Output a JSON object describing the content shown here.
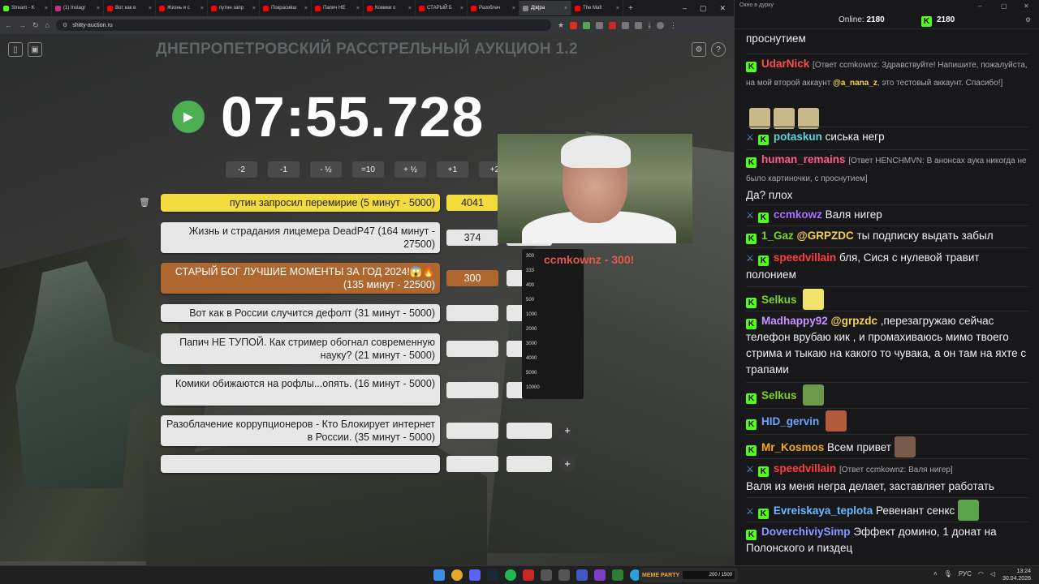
{
  "browser": {
    "tabs": [
      {
        "label": "Stream - K",
        "color": "#53fc18"
      },
      {
        "label": "(1) Instagr",
        "color": "#c13584"
      },
      {
        "label": "Вот как в",
        "color": "#ff0000"
      },
      {
        "label": "Жизнь и с",
        "color": "#ff0000"
      },
      {
        "label": "путин запр",
        "color": "#ff0000"
      },
      {
        "label": "Покрасивш",
        "color": "#ff0000"
      },
      {
        "label": "Папич НЕ",
        "color": "#ff0000"
      },
      {
        "label": "Комики о",
        "color": "#ff0000"
      },
      {
        "label": "СТАРЫЙ Б",
        "color": "#ff0000"
      },
      {
        "label": "Разоблач",
        "color": "#ff0000"
      },
      {
        "label": "Д|в|ра",
        "color": "#888888"
      },
      {
        "label": "The Mafi",
        "color": "#ff0000"
      }
    ],
    "url": "shitty-auction.ru"
  },
  "page": {
    "title": "ДНЕПРОПЕТРОВСКИЙ РАССТРЕЛЬНЫЙ АУКЦИОН 1.2",
    "timer": "07:55.728",
    "time_buttons": [
      "-2",
      "-1",
      "- ½",
      "=10",
      "+ ½",
      "+1",
      "+2"
    ],
    "lots": [
      {
        "title": "путин запросил перемирие (5 минут - 5000)",
        "amount": "4041",
        "style": "yellow"
      },
      {
        "title": "Жизнь и страдания лицемера DeadP47 (164 минут - 27500)",
        "amount": "374",
        "style": "white"
      },
      {
        "title": "СТАРЫЙ БОГ ЛУЧШИЕ МОМЕНТЫ ЗА ГОД 2024!😱🔥 (135 минут - 22500)",
        "amount": "300",
        "style": "orange"
      },
      {
        "title": "Вот как в России случится дефолт (31 минут - 5000)",
        "amount": "",
        "style": "white"
      },
      {
        "title": "Папич НЕ ТУПОЙ. Как стример обогнал современную науку? (21 минут - 5000)",
        "amount": "",
        "style": "white"
      },
      {
        "title": "Комики обижаются на рофлы...опять. (16 минут - 5000)",
        "amount": "",
        "style": "white"
      },
      {
        "title": "Разоблачение коррупционеров - Кто Блокирует интернет в России. (35 минут - 5000)",
        "amount": "",
        "style": "white"
      },
      {
        "title": "",
        "amount": "",
        "style": "white"
      }
    ],
    "donation_text": "ccmkownz - 300!",
    "dropdown_options": [
      "300",
      "333",
      "400",
      "500",
      "1000",
      "2000",
      "3000",
      "4000",
      "5000",
      "10000"
    ]
  },
  "chat": {
    "window_title": "Окно в дурку",
    "online_label": "Online:",
    "online_count": "2180",
    "k_count": "2180",
    "messages": [
      {
        "nick": "",
        "color": "#efeff1",
        "reply": "",
        "text": "проснутием",
        "sword": false
      },
      {
        "nick": "UdarNick",
        "color": "#ff4b4b",
        "reply": "[Ответ ccmkownz: Здравствуйте! Напишите, пожалуйста, на мой второй аккаунт ",
        "mention": "@a_nana_z",
        "reply_tail": ", это тестовый аккаунт. Спасибо!]",
        "text": "",
        "sword": false
      },
      {
        "nick": "potaskun",
        "color": "#5bd6d8",
        "reply": "",
        "text": "сиська негр",
        "sword": true
      },
      {
        "nick": "human_remains",
        "color": "#ff5c8a",
        "reply": "[Ответ HENCHMVN: В анонсах аука никогда не было картиночки, с проснутием]",
        "text": "Да? плох",
        "sword": false
      },
      {
        "nick": "ccmkowz",
        "color": "#a970ff",
        "reply": "",
        "text": "Валя нигер",
        "sword": true
      },
      {
        "nick": "1_Gaz",
        "color": "#7ed321",
        "reply": "",
        "mention": "@GRPZDC",
        "text": "ты подписку выдать забыл",
        "sword": false
      },
      {
        "nick": "speedvillain",
        "color": "#ff3d3d",
        "reply": "",
        "text": "бля, Сися с нулевой травит полонием",
        "sword": true
      },
      {
        "nick": "Selkus",
        "color": "#7ed321",
        "reply": "",
        "text": "",
        "sword": false
      },
      {
        "nick": "Madhappy92",
        "color": "#c792ff",
        "reply": "",
        "mention": "@grpzdc",
        "text": ",перезагружаю сейчас телефон врубаю кик , и промахиваюсь мимо твоего стрима и тыкаю на какого то чувака, а он там на яхте с трапами",
        "sword": false
      },
      {
        "nick": "Selkus",
        "color": "#7ed321",
        "reply": "",
        "text": "",
        "sword": false
      },
      {
        "nick": "HID_gervin",
        "color": "#6aa3ff",
        "reply": "",
        "text": "",
        "sword": false
      },
      {
        "nick": "Mr_Kosmos",
        "color": "#f5a623",
        "reply": "",
        "text": "Всем привет",
        "sword": false
      },
      {
        "nick": "speedvillain",
        "color": "#ff3d3d",
        "reply": "[Ответ ccmkownz: Валя нигер]",
        "text": "Валя из меня негра делает, заставляет работать",
        "sword": true
      },
      {
        "nick": "Evreiskaya_teplota",
        "color": "#6ab8ff",
        "reply": "",
        "text": "Ревенант сенкс",
        "sword": true
      },
      {
        "nick": "DoverchiviySimp",
        "color": "#8a9bff",
        "reply": "",
        "text": "Эффект домино, 1 донат на Полонского и пиздец",
        "sword": false
      }
    ]
  },
  "taskbar": {
    "party_label": "MEME PARTY",
    "party_progress": "200 / 1500",
    "lang": "РУС",
    "time": "13:24",
    "date": "30.04.2026"
  }
}
